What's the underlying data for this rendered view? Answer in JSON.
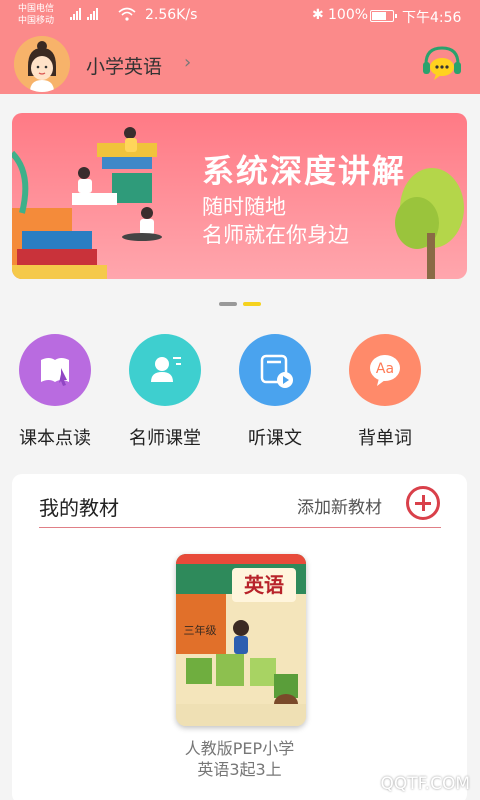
{
  "status_bar": {
    "carrier_1": "中国电信",
    "carrier_2": "中国移动",
    "network_speed": "2.56K/s",
    "battery": "100%",
    "time": "下午4:56"
  },
  "header": {
    "title": "小学英语",
    "chevron": "›",
    "avatar_icon": "girl-avatar-icon",
    "chat_icon": "headset-chat-icon"
  },
  "banner": {
    "title": "系统深度讲解",
    "line1": "随时随地",
    "line2": "名师就在你身边"
  },
  "carousel": {
    "active_index": 1,
    "count": 2
  },
  "quick_actions": [
    {
      "label": "课本点读",
      "icon": "book-touch-icon",
      "color": "#b96be0"
    },
    {
      "label": "名师课堂",
      "icon": "teacher-icon",
      "color": "#3ecfcf"
    },
    {
      "label": "听课文",
      "icon": "video-play-icon",
      "color": "#4aa3ee"
    },
    {
      "label": "背单词",
      "icon": "aa-speech-icon",
      "color": "#ff8a6a"
    }
  ],
  "textbooks": {
    "title": "我的教材",
    "add_label": "添加新教材",
    "book_cover_title": "英语",
    "book_grade": "三年级",
    "book_name_line1": "人教版PEP小学",
    "book_name_line2": "英语3起3上"
  },
  "watermark": "QQTF.COM"
}
